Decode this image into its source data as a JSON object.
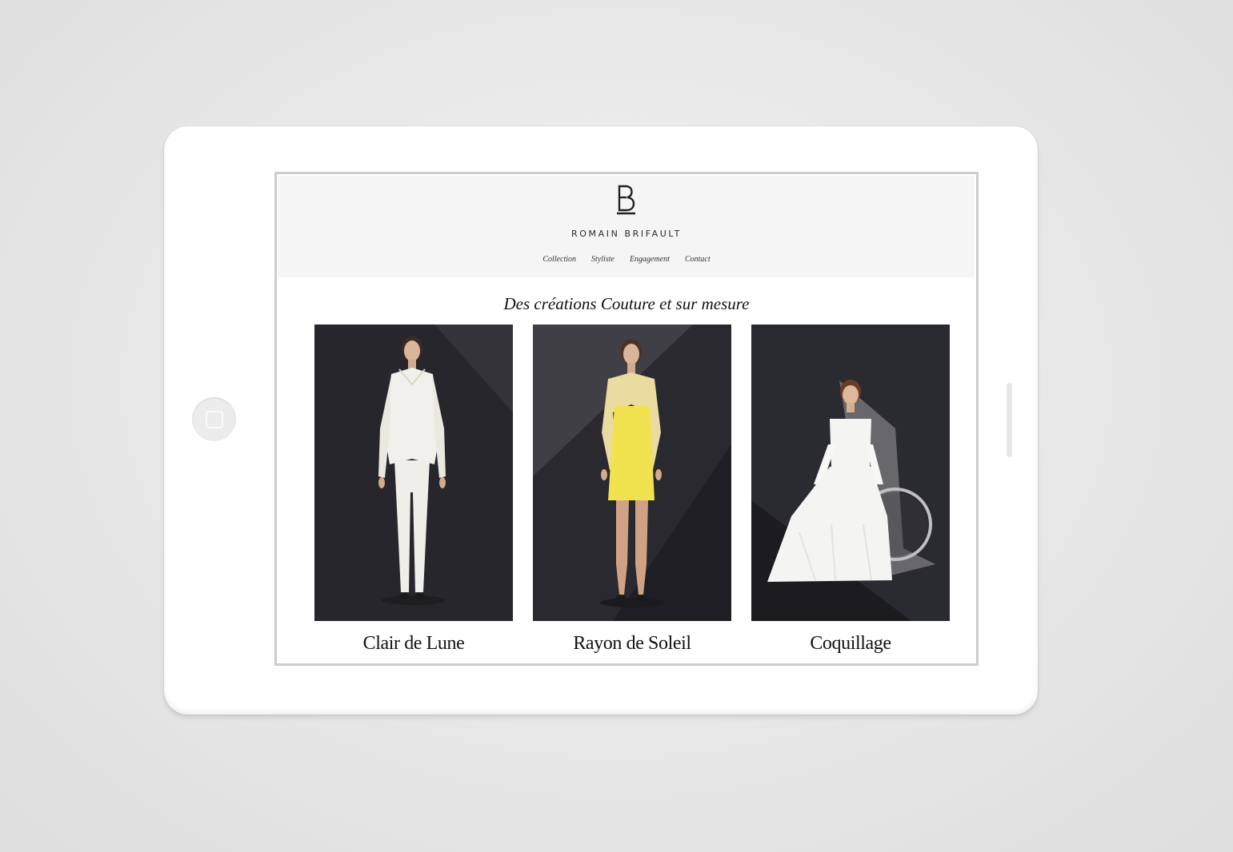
{
  "site": {
    "logo_mark": "B",
    "brand_name": "ROMAIN BRIFAULT",
    "nav": [
      {
        "label": "Collection"
      },
      {
        "label": "Styliste"
      },
      {
        "label": "Engagement"
      },
      {
        "label": "Contact"
      }
    ],
    "tagline": "Des créations Couture et sur mesure",
    "collection": [
      {
        "title": "Clair de Lune",
        "garment_color": "#f2f0ea"
      },
      {
        "title": "Rayon de Soleil",
        "garment_color": "#f1e24f"
      },
      {
        "title": "Coquillage",
        "garment_color": "#f4f4f2"
      }
    ]
  },
  "colors": {
    "header_bg": "#f5f5f5",
    "photo_bg": "#2b2a31",
    "text": "#111111"
  },
  "icons": {
    "home": "home-button-icon",
    "logo": "logo-b-icon"
  }
}
